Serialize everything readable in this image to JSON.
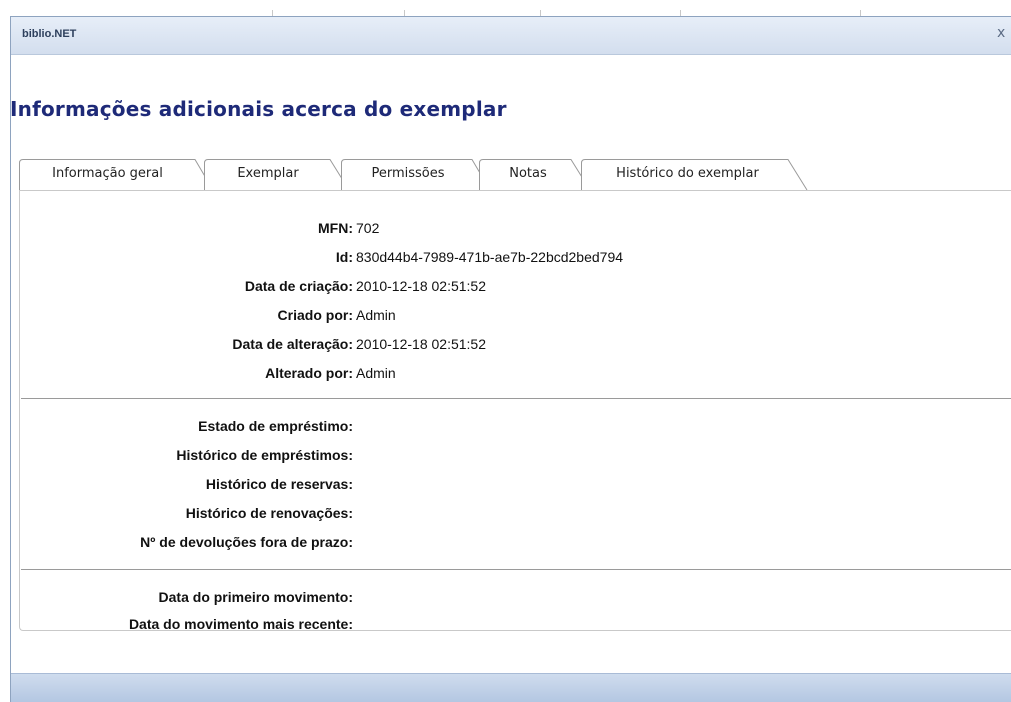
{
  "window": {
    "title": "biblio.NET",
    "close_label": "x"
  },
  "page": {
    "heading": "Informações adicionais acerca do exemplar"
  },
  "tabs": [
    {
      "label": "Informação geral",
      "active": true
    },
    {
      "label": "Exemplar",
      "active": false
    },
    {
      "label": "Permissões",
      "active": false
    },
    {
      "label": "Notas",
      "active": false
    },
    {
      "label": "Histórico do exemplar",
      "active": false
    }
  ],
  "general": {
    "fields": [
      {
        "label": "MFN:",
        "value": "702"
      },
      {
        "label": "Id:",
        "value": "830d44b4-7989-471b-ae7b-22bcd2bed794"
      },
      {
        "label": "Data de criação:",
        "value": "2010-12-18 02:51:52"
      },
      {
        "label": "Criado por:",
        "value": "Admin"
      },
      {
        "label": "Data de alteração:",
        "value": "2010-12-18 02:51:52"
      },
      {
        "label": "Alterado por:",
        "value": "Admin"
      }
    ],
    "loans": [
      {
        "label": "Estado de empréstimo:",
        "value": ""
      },
      {
        "label": "Histórico de empréstimos:",
        "value": ""
      },
      {
        "label": "Histórico de reservas:",
        "value": ""
      },
      {
        "label": "Histórico de renovações:",
        "value": ""
      },
      {
        "label": "Nº de devoluções fora de prazo:",
        "value": ""
      }
    ],
    "movements": [
      {
        "label": "Data do primeiro movimento:",
        "value": ""
      },
      {
        "label": "Data do movimento mais recente:",
        "value": ""
      }
    ]
  }
}
